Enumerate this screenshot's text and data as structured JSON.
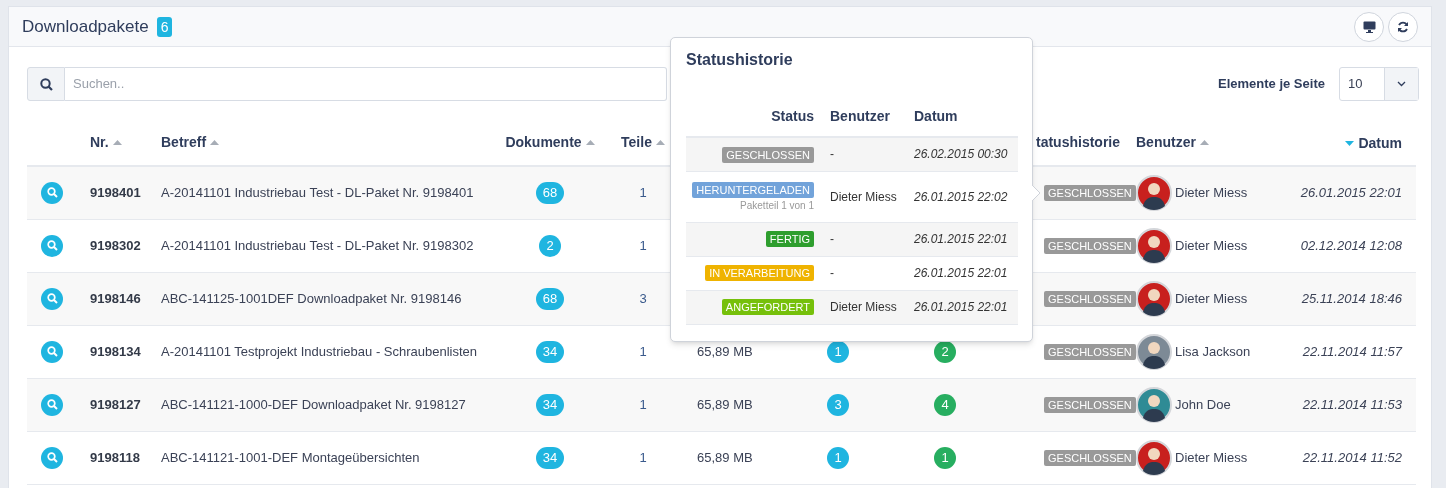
{
  "panel": {
    "title": "Downloadpakete",
    "count": "6"
  },
  "search": {
    "placeholder": "Suchen.."
  },
  "page_size": {
    "label": "Elemente je Seite",
    "value": "10"
  },
  "table": {
    "columns": [
      {
        "label": "Nr.",
        "sortable": true,
        "sorted": false
      },
      {
        "label": "Betreff",
        "sortable": true,
        "sorted": false
      },
      {
        "label": "Dokumente",
        "sortable": true,
        "sorted": false
      },
      {
        "label": "Teile",
        "sortable": true,
        "sorted": false
      },
      {
        "label": "tatushistorie"
      },
      {
        "label": "Benutzer",
        "sortable": true,
        "sorted": false
      },
      {
        "label": "Datum",
        "sortable": true,
        "sorted": true
      }
    ],
    "rows": [
      {
        "nr": "9198401",
        "betreff": "A-20141101 Industriebau Test - DL-Paket Nr. 9198401",
        "dokumente": "68",
        "teile": "1",
        "status": "GESCHLOSSEN",
        "user": {
          "name": "Dieter Miess",
          "color": "#c8201e"
        },
        "datum": "26.01.2015 22:01"
      },
      {
        "nr": "9198302",
        "betreff": "A-20141101 Industriebau Test - DL-Paket Nr. 9198302",
        "dokumente": "2",
        "teile": "1",
        "status": "GESCHLOSSEN",
        "user": {
          "name": "Dieter Miess",
          "color": "#c8201e"
        },
        "datum": "02.12.2014 12:08"
      },
      {
        "nr": "9198146",
        "betreff": "ABC-141125-1001DEF Downloadpaket Nr. 9198146",
        "dokumente": "68",
        "teile": "3",
        "status": "GESCHLOSSEN",
        "user": {
          "name": "Dieter Miess",
          "color": "#c8201e"
        },
        "datum": "25.11.2014 18:46"
      },
      {
        "nr": "9198134",
        "betreff": "A-20141101 Testprojekt Industriebau - Schraubenlisten",
        "dokumente": "34",
        "teile": "1",
        "groesse": "65,89 MB",
        "count_a": "1",
        "count_b": "2",
        "status": "GESCHLOSSEN",
        "user": {
          "name": "Lisa Jackson",
          "color": "#7d8a96"
        },
        "datum": "22.11.2014 11:57"
      },
      {
        "nr": "9198127",
        "betreff": "ABC-141121-1000-DEF Downloadpaket Nr. 9198127",
        "dokumente": "34",
        "teile": "1",
        "groesse": "65,89 MB",
        "count_a": "3",
        "count_b": "4",
        "status": "GESCHLOSSEN",
        "user": {
          "name": "John Doe",
          "color": "#2f8b95"
        },
        "datum": "22.11.2014 11:53"
      },
      {
        "nr": "9198118",
        "betreff": "ABC-141121-1001-DEF Montageübersichten",
        "dokumente": "34",
        "teile": "1",
        "groesse": "65,89 MB",
        "count_a": "1",
        "count_b": "1",
        "status": "GESCHLOSSEN",
        "user": {
          "name": "Dieter Miess",
          "color": "#c8201e"
        },
        "datum": "22.11.2014 11:52"
      }
    ]
  },
  "popover": {
    "title": "Statushistorie",
    "columns": [
      "Status",
      "Benutzer",
      "Datum"
    ],
    "rows": [
      {
        "status": "GESCHLOSSEN",
        "color": "#999999",
        "benutzer": "-",
        "datum": "26.02.2015 00:30"
      },
      {
        "status": "HERUNTERGELADEN",
        "color": "#72a3da",
        "note": "Paketteil 1 von 1",
        "benutzer": "Dieter Miess",
        "datum": "26.01.2015 22:02"
      },
      {
        "status": "FERTIG",
        "color": "#2e9e2e",
        "benutzer": "-",
        "datum": "26.01.2015 22:01"
      },
      {
        "status": "IN VERARBEITUNG",
        "color": "#efb300",
        "benutzer": "-",
        "datum": "26.01.2015 22:01"
      },
      {
        "status": "ANGEFORDERT",
        "color": "#76c00b",
        "benutzer": "Dieter Miess",
        "datum": "26.01.2015 22:01"
      }
    ]
  }
}
